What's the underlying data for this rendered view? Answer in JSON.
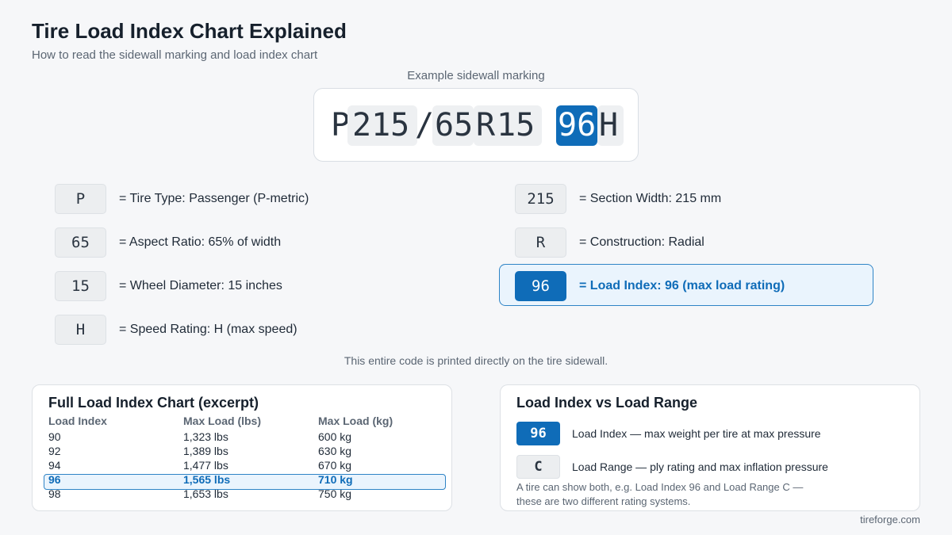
{
  "header": {
    "title": "Tire Load Index Chart Explained",
    "subtitle": "How to read the sidewall marking and load index chart"
  },
  "marking": {
    "label": "Example sidewall marking",
    "segments": [
      "P",
      "215",
      "/",
      "65",
      "R",
      "15",
      "96",
      "H"
    ]
  },
  "legend": {
    "items": [
      {
        "code": "P",
        "desc": "= Tire Type: Passenger (P-metric)"
      },
      {
        "code": "215",
        "desc": "= Section Width: 215 mm"
      },
      {
        "code": "65",
        "desc": "= Aspect Ratio: 65% of width"
      },
      {
        "code": "R",
        "desc": "= Construction: Radial"
      },
      {
        "code": "15",
        "desc": "= Wheel Diameter: 15 inches"
      },
      {
        "code": "96",
        "desc": "= Load Index: 96 (max load rating)"
      },
      {
        "code": "H",
        "desc": "= Speed Rating: H (max speed)"
      }
    ],
    "note": "This entire code is printed directly on the tire sidewall."
  },
  "load_chart": {
    "title": "Full Load Index Chart (excerpt)",
    "headers": [
      "Load Index",
      "Max Load (lbs)",
      "Max Load (kg)"
    ],
    "rows": [
      [
        "90",
        "1,323 lbs",
        "600 kg"
      ],
      [
        "92",
        "1,389 lbs",
        "630 kg"
      ],
      [
        "94",
        "1,477 lbs",
        "670 kg"
      ],
      [
        "96",
        "1,565 lbs",
        "710 kg"
      ],
      [
        "98",
        "1,653 lbs",
        "750 kg"
      ]
    ],
    "highlighted_row": 3
  },
  "comparison": {
    "title": "Load Index vs Load Range",
    "items": [
      {
        "code": "96",
        "desc": "Load Index — max weight per tire at max pressure"
      },
      {
        "code": "C",
        "desc": "Load Range — ply rating and max inflation pressure"
      }
    ],
    "note_line1": "A tire can show both, e.g. Load Index 96 and Load Range C —",
    "note_line2": "these are two different rating systems."
  },
  "footer": {
    "brand": "tireforge.com"
  },
  "colors": {
    "accent": "#0f6cb8",
    "highlight_bg": "#eaf4fd"
  }
}
